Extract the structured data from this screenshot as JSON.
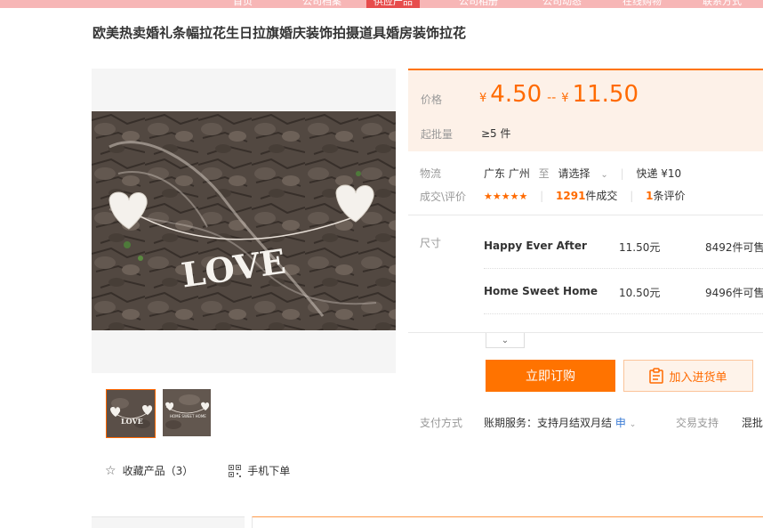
{
  "nav": {
    "tabs": [
      {
        "label": "首页",
        "active": false
      },
      {
        "label": "公司档案",
        "active": false
      },
      {
        "label": "供应产品",
        "active": true
      },
      {
        "label": "公司相册",
        "active": false
      },
      {
        "label": "公司动态",
        "active": false
      },
      {
        "label": "在线购物",
        "active": false
      },
      {
        "label": "联系方式",
        "active": false
      }
    ]
  },
  "product": {
    "title": "欧美热卖婚礼条幅拉花生日拉旗婚庆装饰拍摄道具婚房装饰拉花",
    "image_text": "LOVE"
  },
  "gallery": {
    "thumb1_text": "LOVE",
    "thumb2_text": "HOME SWEET HOME",
    "favorite_label": "收藏产品（3）",
    "mobile_label": "手机下单"
  },
  "price": {
    "label": "价格",
    "currency": "¥",
    "min": "4.50",
    "sep": "--",
    "max": "11.50",
    "moq_label": "起批量",
    "moq_value": "≥5 件"
  },
  "logistics": {
    "label": "物流",
    "from": "广东 广州",
    "to_word": "至",
    "select": "请选择",
    "express": "快递 ¥10"
  },
  "deals": {
    "label": "成交\\评价",
    "stars": "★★★★★",
    "deal_count": "1291",
    "deal_suffix": "件成交",
    "review_count": "1",
    "review_suffix": "条评价"
  },
  "sku": {
    "label": "尺寸",
    "items": [
      {
        "name": "Happy Ever After",
        "price": "11.50元",
        "stock": "8492件可售"
      },
      {
        "name": "Home Sweet Home",
        "price": "10.50元",
        "stock": "9496件可售"
      }
    ]
  },
  "actions": {
    "buy": "立即订购",
    "cart": "加入进货单"
  },
  "payment": {
    "label": "支付方式",
    "service": "账期服务：支持月结双月结",
    "apply": "申",
    "trade_label": "交易支持",
    "trade_value": "混批"
  },
  "colors": {
    "accent": "#ff7300",
    "price": "#ff6a00",
    "nav_active": "#e74c4c",
    "nav_bg": "#f7b6b6"
  }
}
